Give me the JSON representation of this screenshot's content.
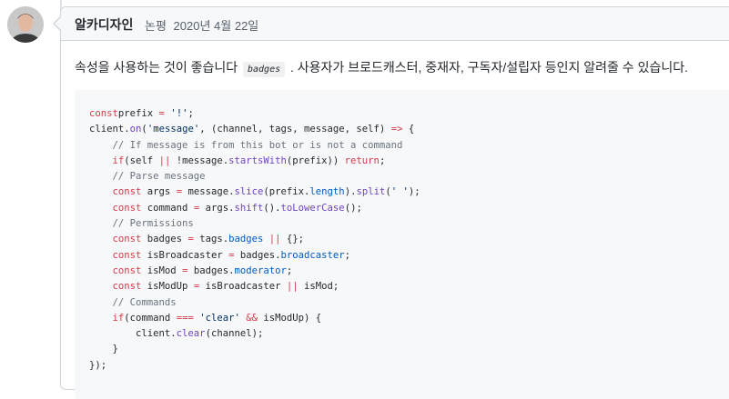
{
  "comment": {
    "author": "알카디자인",
    "action": "논평",
    "date": "2020년 4월 22일",
    "menu_icon": "ellipsis-icon",
    "avatar_icon": "user-avatar",
    "body_before": "속성을 사용하는 것이 좋습니다",
    "inline_code": "badges",
    "body_after": ". 사용자가 브로드캐스터, 중재자, 구독자/설립자 등인지 알려줄 수 있습니다."
  },
  "code_lines": [
    [
      [
        "kw",
        "const"
      ],
      [
        "",
        "prefix "
      ],
      [
        "op",
        "="
      ],
      [
        "",
        ""
      ],
      [
        "str",
        " '!'"
      ],
      [
        "",
        ";"
      ]
    ],
    [
      [
        "",
        "client."
      ],
      [
        "fn",
        "on"
      ],
      [
        "",
        "("
      ],
      [
        "str",
        "'message'"
      ],
      [
        "",
        ", (channel, tags, message, self) "
      ],
      [
        "op",
        "=>"
      ],
      [
        "",
        ""
      ],
      [
        "",
        " {"
      ]
    ],
    [
      [
        "",
        ""
      ],
      [
        "cm",
        "    // If message is from this bot or is not a command"
      ]
    ],
    [
      [
        "",
        "    "
      ],
      [
        "kw",
        "if"
      ],
      [
        "",
        "(self "
      ],
      [
        "op",
        "||"
      ],
      [
        "",
        ""
      ],
      [
        "",
        " !message."
      ],
      [
        "fn",
        "startsWith"
      ],
      [
        "",
        "(prefix)) "
      ],
      [
        "kw",
        "return"
      ],
      [
        "",
        ";"
      ]
    ],
    [
      [
        "",
        ""
      ],
      [
        "cm",
        "    // Parse message"
      ]
    ],
    [
      [
        "",
        "    "
      ],
      [
        "kw",
        "const"
      ],
      [
        "",
        ""
      ],
      [
        "",
        " args "
      ],
      [
        "op",
        "="
      ],
      [
        "",
        " message."
      ],
      [
        "fn",
        "slice"
      ],
      [
        "",
        "(prefix."
      ],
      [
        "prop",
        "length"
      ],
      [
        "",
        ")."
      ],
      [
        "fn",
        "split"
      ],
      [
        "",
        "("
      ],
      [
        "str",
        "' '"
      ],
      [
        "",
        ");"
      ]
    ],
    [
      [
        "",
        "    "
      ],
      [
        "kw",
        "const"
      ],
      [
        "",
        " command "
      ],
      [
        "op",
        "="
      ],
      [
        "",
        " args."
      ],
      [
        "fn",
        "shift"
      ],
      [
        "",
        "()."
      ],
      [
        "fn",
        "toLowerCase"
      ],
      [
        "",
        "();"
      ]
    ],
    [
      [
        "",
        ""
      ],
      [
        "cm",
        "    // Permissions"
      ]
    ],
    [
      [
        "",
        "    "
      ],
      [
        "kw",
        "const"
      ],
      [
        "",
        " badges "
      ],
      [
        "op",
        "="
      ],
      [
        "",
        " tags."
      ],
      [
        "prop",
        "badges"
      ],
      [
        "",
        " "
      ],
      [
        "op",
        "||"
      ],
      [
        "",
        " {};"
      ]
    ],
    [
      [
        "",
        "    "
      ],
      [
        "kw",
        "const"
      ],
      [
        "",
        " isBroadcaster "
      ],
      [
        "op",
        "="
      ],
      [
        "",
        " badges."
      ],
      [
        "prop",
        "broadcaster"
      ],
      [
        "",
        ";"
      ]
    ],
    [
      [
        "",
        "    "
      ],
      [
        "kw",
        "const"
      ],
      [
        "",
        " isMod "
      ],
      [
        "op",
        "="
      ],
      [
        "",
        " badges."
      ],
      [
        "prop",
        "moderator"
      ],
      [
        "",
        ";"
      ]
    ],
    [
      [
        "",
        "    "
      ],
      [
        "kw",
        "const"
      ],
      [
        "",
        " isModUp "
      ],
      [
        "op",
        "="
      ],
      [
        "",
        " isBroadcaster "
      ],
      [
        "op",
        "||"
      ],
      [
        "",
        " isMod;"
      ]
    ],
    [
      [
        "",
        ""
      ],
      [
        "cm",
        "    // Commands"
      ]
    ],
    [
      [
        "",
        "    "
      ],
      [
        "kw",
        "if"
      ],
      [
        "",
        "(command "
      ],
      [
        "op",
        "==="
      ],
      [
        "",
        " "
      ],
      [
        "str",
        "'clear'"
      ],
      [
        "",
        " "
      ],
      [
        "op",
        "&&"
      ],
      [
        "",
        " isModUp) {"
      ]
    ],
    [
      [
        "",
        "        client."
      ],
      [
        "fn",
        "clear"
      ],
      [
        "",
        "(channel);"
      ]
    ],
    [
      [
        "",
        "    }"
      ]
    ],
    [
      [
        "",
        "});"
      ]
    ]
  ]
}
